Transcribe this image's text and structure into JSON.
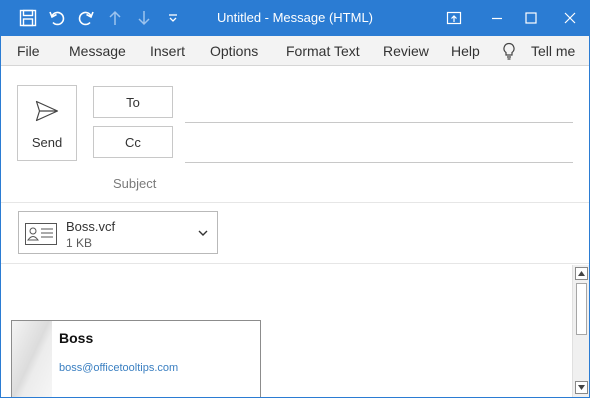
{
  "window": {
    "title": "Untitled  -  Message (HTML)"
  },
  "quick_access": {
    "icons": [
      "save-icon",
      "undo-icon",
      "redo-icon",
      "previous-item-icon",
      "next-item-icon",
      "customize-toolbar-icon"
    ]
  },
  "window_controls": {
    "icons": [
      "restore-ribbon-icon",
      "minimize-icon",
      "maximize-icon",
      "close-icon"
    ]
  },
  "menu": {
    "items": [
      "File",
      "Message",
      "Insert",
      "Options",
      "Format Text",
      "Review",
      "Help"
    ],
    "tell_me": "Tell me"
  },
  "compose": {
    "send_label": "Send",
    "to_label": "To",
    "cc_label": "Cc",
    "subject_label": "Subject",
    "to_value": "",
    "cc_value": "",
    "subject_value": ""
  },
  "attachment": {
    "name": "Boss.vcf",
    "size": "1 KB"
  },
  "card": {
    "name": "Boss",
    "email": "boss@officetooltips.com"
  },
  "colors": {
    "title_bar": "#2b7cd3",
    "menu_bar": "#f3f3f3",
    "link": "#3a7fc1"
  }
}
